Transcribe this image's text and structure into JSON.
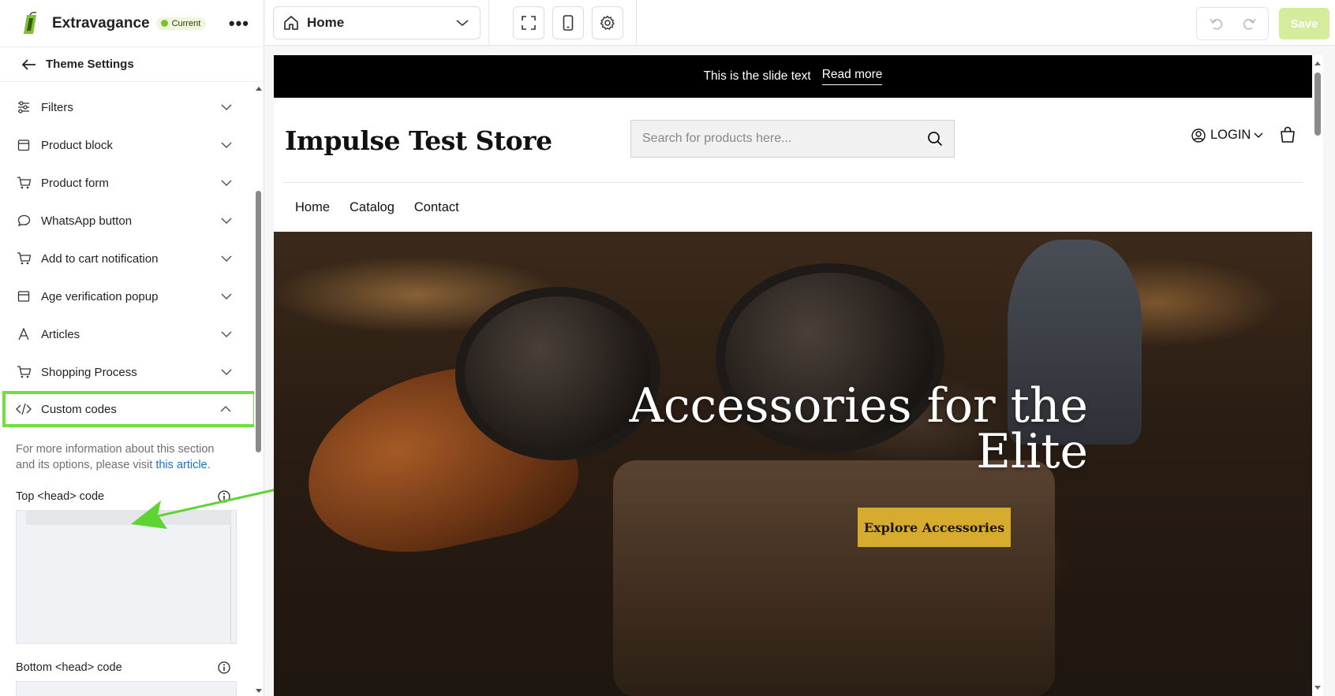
{
  "app": {
    "name": "Extravagance",
    "badge": "Current",
    "more": "•••"
  },
  "sidebar": {
    "back_label": "Theme Settings",
    "items": [
      {
        "label": "Filters",
        "icon": "sliders-icon"
      },
      {
        "label": "Product block",
        "icon": "box-icon"
      },
      {
        "label": "Product form",
        "icon": "cart-icon"
      },
      {
        "label": "WhatsApp button",
        "icon": "chat-bubble-icon"
      },
      {
        "label": "Add to cart notification",
        "icon": "cart-icon"
      },
      {
        "label": "Age verification popup",
        "icon": "window-icon"
      },
      {
        "label": "Articles",
        "icon": "font-icon"
      },
      {
        "label": "Shopping Process",
        "icon": "cart-icon"
      }
    ],
    "active_item": {
      "label": "Custom codes",
      "icon": "code-icon",
      "highlight_color": "#6ee23a"
    },
    "section_info": {
      "text": "For more information about this section and its options, please visit ",
      "link": "this article",
      "end": "."
    },
    "fields": {
      "top_head_label": "Top <head> code",
      "bottom_head_label": "Bottom <head> code"
    }
  },
  "toolbar": {
    "page_select": "Home",
    "fullscreen_icon": "expand-icon",
    "mobile_icon": "mobile-icon",
    "settings_icon": "gear-icon",
    "undo_icon": "undo-icon",
    "redo_icon": "redo-icon",
    "save_label": "Save",
    "save_color": "#d4ec9c"
  },
  "preview": {
    "announcement": {
      "text": "This is the slide text",
      "link": "Read more"
    },
    "store_title": "Impulse Test Store",
    "search_placeholder": "Search for products here...",
    "login_label": "LOGIN",
    "nav": [
      "Home",
      "Catalog",
      "Contact"
    ],
    "hero": {
      "title_line1": "Accessories for the",
      "title_line2": "Elite",
      "button": "Explore Accessories",
      "button_color": "#d6ab2e"
    }
  }
}
